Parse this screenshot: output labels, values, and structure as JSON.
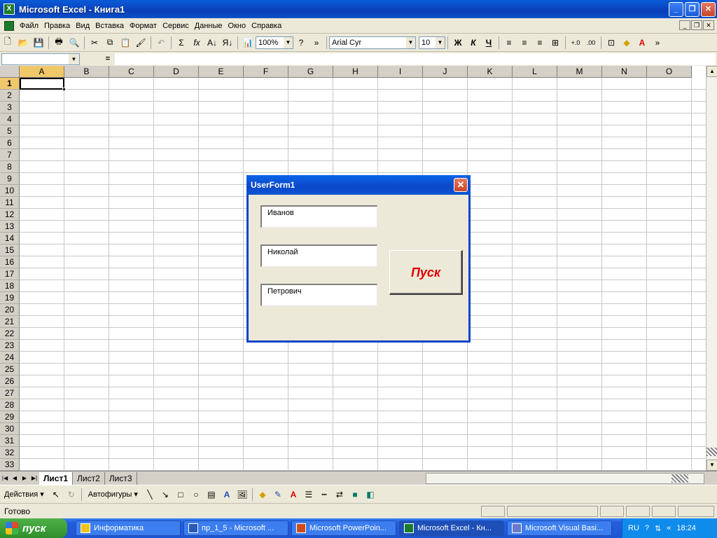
{
  "window": {
    "title": "Microsoft Excel - Книга1",
    "minimize": "_",
    "restore": "❐",
    "close": "✕"
  },
  "menu": {
    "items": [
      "Файл",
      "Правка",
      "Вид",
      "Вставка",
      "Формат",
      "Сервис",
      "Данные",
      "Окно",
      "Справка"
    ]
  },
  "toolbar": {
    "zoom": "100%",
    "font_name": "Arial Cyr",
    "font_size": "10",
    "bold": "Ж",
    "italic": "К",
    "underline": "Ч"
  },
  "formula_bar": {
    "name_box": "",
    "equals": "=",
    "formula": ""
  },
  "grid": {
    "columns": [
      "A",
      "B",
      "C",
      "D",
      "E",
      "F",
      "G",
      "H",
      "I",
      "J",
      "K",
      "L",
      "M",
      "N",
      "O"
    ],
    "rows": [
      "1",
      "2",
      "3",
      "4",
      "5",
      "6",
      "7",
      "8",
      "9",
      "10",
      "11",
      "12",
      "13",
      "14",
      "15",
      "16",
      "17",
      "18",
      "19",
      "20",
      "21",
      "22",
      "23",
      "24",
      "25",
      "26",
      "27",
      "28",
      "29",
      "30",
      "31",
      "32",
      "33"
    ],
    "active_cell": "A1"
  },
  "sheets": {
    "tabs": [
      "Лист1",
      "Лист2",
      "Лист3"
    ],
    "active": "Лист1"
  },
  "drawing_toolbar": {
    "actions": "Действия ▾",
    "autoshapes": "Автофигуры ▾"
  },
  "status": {
    "text": "Готово"
  },
  "taskbar": {
    "start": "пуск",
    "tasks": [
      {
        "label": "Информатика",
        "active": false
      },
      {
        "label": "пр_1_5 - Microsoft ...",
        "active": false
      },
      {
        "label": "Microsoft PowerPoin...",
        "active": false
      },
      {
        "label": "Microsoft Excel - Кн...",
        "active": true
      },
      {
        "label": "Microsoft Visual Basi...",
        "active": false
      }
    ],
    "language": "RU",
    "time": "18:24"
  },
  "userform": {
    "title": "UserForm1",
    "close": "✕",
    "textboxes": [
      "Иванов",
      "Николай",
      "Петрович"
    ],
    "button": "Пуск"
  },
  "colors": {
    "titlebar": "#0a46c8",
    "button_text": "#e00000",
    "selection_header": "#f0c86a",
    "taskbar": "#245edb"
  }
}
